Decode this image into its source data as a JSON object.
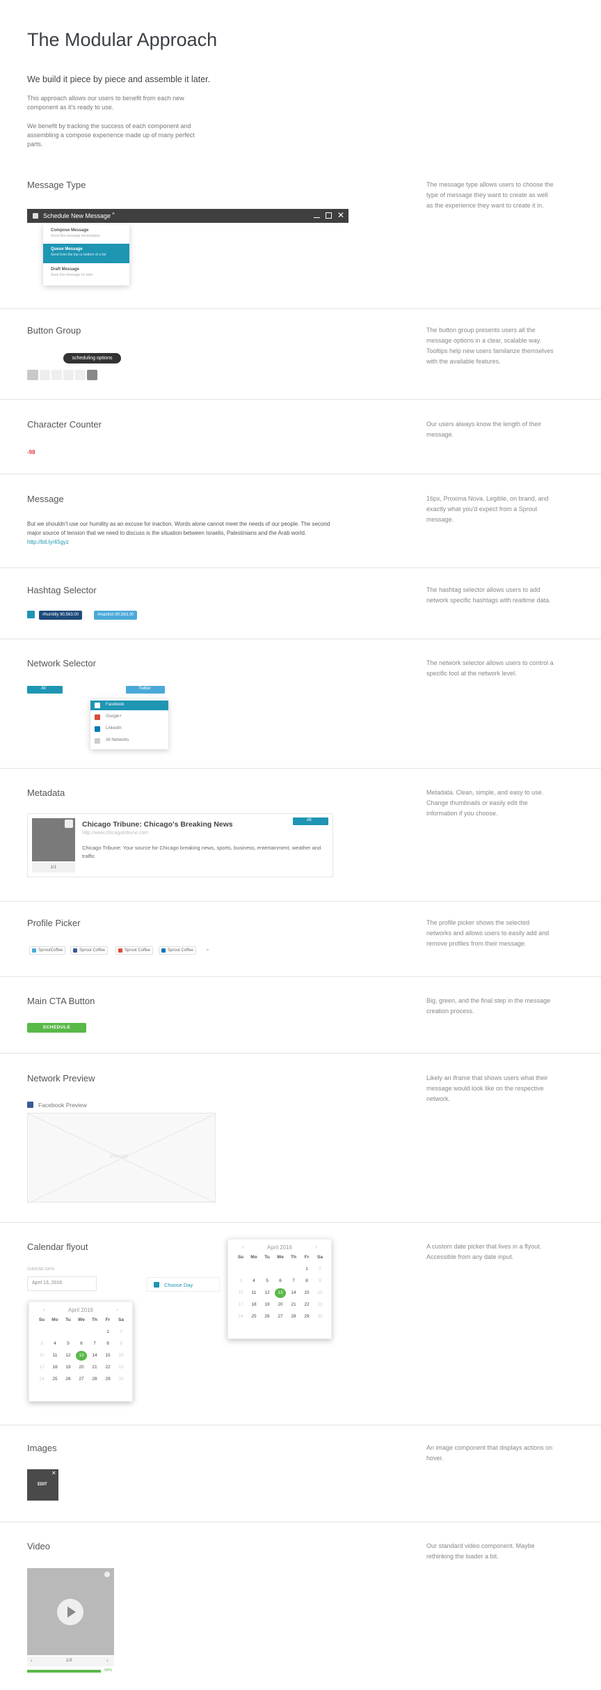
{
  "header": {
    "title": "The Modular Approach",
    "lead": "We build it piece by piece and assemble it later.",
    "para1": "This approach allows our users to benefit from each new component as it's ready to use.",
    "para2": "We benefit by tracking the success of each component and assembling a compose experience made up of many perfect parts."
  },
  "sections": {
    "message_type": {
      "title": "Message Type",
      "desc": "The message type allows users to choose the type of message they want to create as well as the experience they want to create it in.",
      "bar_label": "Schedule New Message",
      "menu": [
        {
          "title": "Compose Message",
          "sub": "Send this message immediately"
        },
        {
          "title": "Queue Message",
          "sub": "Send from the top or bottom of a list"
        },
        {
          "title": "Draft Message",
          "sub": "Save this message for later"
        }
      ]
    },
    "button_group": {
      "title": "Button Group",
      "desc": "The button group presents users all the message options in a clear, scalable way. Tooltips help new users familarize themselves with the available features.",
      "tooltip": "scheduling options"
    },
    "char_counter": {
      "title": "Character Counter",
      "desc": "Our users always know the length of their message.",
      "value": "-98"
    },
    "message": {
      "title": "Message",
      "desc": "16px, Proxima Nova. Legible, on brand, and exactly what you'd expect from a Sprout message.",
      "body": "But we shouldn't use our humility as an excuse for inaction. Words alone cannot meet the needs of our people. The second major source of tension that we need to discuss is the situation between Israelis, Palestinians and the Arab world.",
      "link": "http://bit.ly/45gyz"
    },
    "hashtag": {
      "title": "Hashtag Selector",
      "desc": "The hashtag selector allows users to add network specific hashtags with realtime data.",
      "tags": [
        "#humility 80,563.00",
        "#inaction 80,563.00"
      ]
    },
    "network": {
      "title": "Network Selector",
      "desc": "The network selector allows users to control a specific tool at the network level.",
      "all_label": "All",
      "twitter_label": "Twitter",
      "options": [
        "Facebook",
        "Google+",
        "LinkedIn",
        "All Networks"
      ]
    },
    "metadata": {
      "title": "Metadata",
      "desc": "Metadata. Clean, simple, and easy to use. Change thumbnails or easily edit the information if you choose.",
      "card_title": "Chicago Tribune: Chicago's Breaking News",
      "url": "http://www.chicagotribune.com",
      "card_desc": "Chicago Tribune: Your source for Chicago breaking news, sports, business, entertainment, weather and traffic",
      "pager": "1/1",
      "all_label": "All"
    },
    "profile": {
      "title": "Profile Picker",
      "desc": "The profile picker shows the selected networks and allows users to easily add and remove profiles from their message.",
      "chips": [
        "SproutCoffee",
        "Sprout Coffee",
        "Sprout Coffee",
        "Sprout Coffee"
      ]
    },
    "cta": {
      "title": "Main CTA Button",
      "desc": "Big, green, and the final step in the message creation process.",
      "button": "SCHEDULE"
    },
    "preview": {
      "title": "Network Preview",
      "desc": "Likely an iframe that shows users what their message would look like on the respective network.",
      "label": "Facebook Preview",
      "iframe": "IFRAME"
    },
    "calendar": {
      "title": "Calendar flyout",
      "desc": "A custom date picker that lives in a flyout. Accessible from any date input.",
      "field_label": "choose date",
      "field_value": "April 13, 2016",
      "choose_day": "Choose Day",
      "month": "April 2016",
      "dow": [
        "Su",
        "Mo",
        "Tu",
        "We",
        "Th",
        "Fr",
        "Sa"
      ]
    },
    "images": {
      "title": "Images",
      "desc": "An image component that displays actions on hover.",
      "edit": "EDIT"
    },
    "video": {
      "title": "Video",
      "desc": "Our standard video component. Maybe rethinking the loader a bit.",
      "pager": "1/3",
      "progress_label": "99%",
      "progress": 0.99
    }
  },
  "colors": {
    "accent": "#1e95b3",
    "green": "#59b948",
    "red": "#e0384a",
    "dark": "#3a3a3a",
    "navy": "#1e4a7a"
  }
}
